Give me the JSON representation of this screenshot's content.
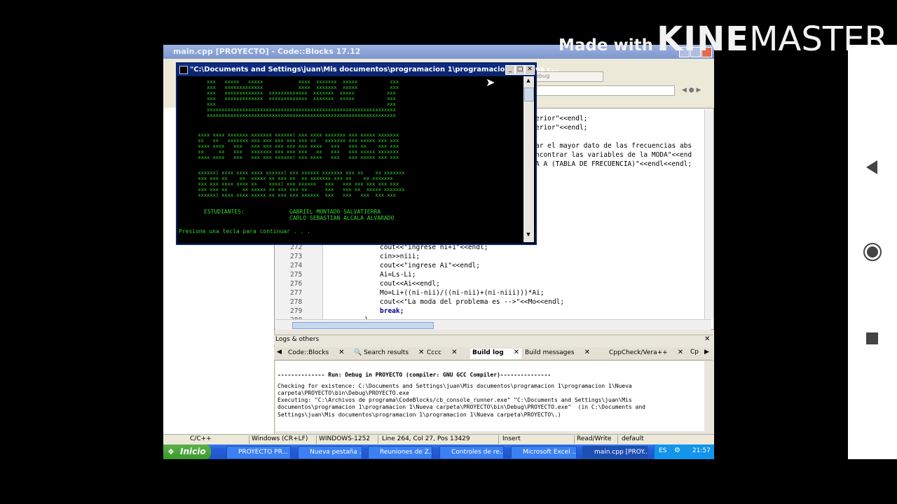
{
  "watermark": {
    "made_with": "Made with",
    "ki": "KINE",
    "master": "MASTER"
  },
  "codeblocks": {
    "title": "main.cpp [PROYECTO] - Code::Blocks 17.12",
    "build_target_hint": "ebug",
    "partial_code": [
      "erior\"<<endl;",
      "erior\"<<endl;",
      "ar el mayor dato de las frecuencias abs",
      "ncontrar las variables de la MODA\"<<end",
      "A A (TABLA DE FRECUENCIA)\"<<endl<<endl;"
    ],
    "code_lines": [
      {
        "num": "272",
        "text": "cout<<\"ingrese ni+1\"<<endl;"
      },
      {
        "num": "273",
        "text": "cin>>niii;"
      },
      {
        "num": "274",
        "text": "cout<<\"ingrese Ai\"<<endl;"
      },
      {
        "num": "275",
        "text": "Ai=Ls-Li;"
      },
      {
        "num": "276",
        "text": "cout<<Ai<<endl;"
      },
      {
        "num": "277",
        "text": "Mo=Li+((ni-nii)/((ni-nii)+(ni-niii)))*Ai;"
      },
      {
        "num": "278",
        "text": "cout<<\"La moda del problema es -->\"<<Mo<<endl;"
      },
      {
        "num": "279",
        "text": "break;"
      },
      {
        "num": "280",
        "text": "}"
      }
    ],
    "logs_title": "Logs & others",
    "log_tabs": [
      "Code::Blocks",
      "Search results",
      "Cccc",
      "Build log",
      "Build messages",
      "CppCheck/Vera++",
      "Cp"
    ],
    "active_tab": "Build log",
    "log_lines": [
      "-------------- Run: Debug in PROYECTO (compiler: GNU GCC Compiler)---------------",
      "Checking for existence: C:\\Documents and Settings\\juan\\Mis documentos\\programacion 1\\programacion 1\\Nueva",
      "carpeta\\PROYECTO\\bin\\Debug\\PROYECTO.exe",
      "Executing: \"C:\\Archivos de programa\\CodeBlocks/cb_console_runner.exe\" \"C:\\Documents and Settings\\juan\\Mis",
      "documentos\\programacion 1\\programacion 1\\Nueva carpeta\\PROYECTO\\bin\\Debug\\PROYECTO.exe\"  (in C:\\Documents and",
      "Settings\\juan\\Mis documentos\\programacion 1\\programacion 1\\Nueva carpeta\\PROYECTO\\.)"
    ],
    "status": {
      "lang": "C/C++",
      "eol": "Windows (CR+LF)",
      "encoding": "WINDOWS-1252",
      "position": "Line 264, Col 27, Pos 13429",
      "mode": "Insert",
      "access": "Read/Write",
      "profile": "default"
    }
  },
  "console": {
    "title": "\"C:\\Documents and Settings\\juan\\Mis documentos\\programacion 1\\programacion 1\\Nueva c...",
    "art1": [
      "          xxx   xxxxx   xxxxx            xxxx  xxxxxxx  xxxxx           xxx",
      "          xxx   xxxxxxxxxxxxx            xxxx  xxxxxxx  xxxxx           xxx",
      "          xxx   xxxxxxxxxxxxx  xxxxxxxxxxxxx  xxxxxxx  xxxxx           xxx",
      "          xxx   xxxxxxxxxxxxx  xxxxxxxxxxxxx  xxxxxxx  xxxxx           xxx",
      "          xxx                                                          xxx",
      "          xxxxxxxxxxxxxxxxxxxxxxxxxxxxxxxxxxxxxxxxxxxxxxxxxxxxxxxxxxxxxxxx",
      "          xxxxxxxxxxxxxxxxxxxxxxxxxxxxxxxxxxxxxxxxxxxxxxxxxxxxxxxxxxxxxxxx"
    ],
    "art2": [
      "       xxxx xxxx xxxxxxx xxxxxxx xxxxxx) xxx xxxx xxxxxxx xxx xxxxx xxxxxxx",
      "       xx   xx   xxxxxxx xxx xxx xxx xxx xxx xx   xxxxxxx xxx xxxxx xxx xxx",
      "       xxxx xxxx   xxx   xxx xxx xxx xxx xxx xxxx   xxx   xxx xx    xxx xxx",
      "       xx     xx   xxx   xxxxxxx xxx xxx xxx   xx   xxx   xxx xxxxx xxxxxxx",
      "       xxxx xxxx   xxx   xxx xxx xxxxxx) xxx xxxx   xxx   xxx xxxxx xxx xxx"
    ],
    "art3": [
      "       xxxxxx) xxxx xxxx xxxx xxxxxx) xxx xxxxxx xxxxxxx xxx xx    xx xxxxxxx",
      "       xxx xxx xx    xx  xxxxx xx xxx xx  xx xxxxxxx xxx xx    xx xxxxxxx",
      "       xxx xxx xxxx xxxx xx    xxxx) xxx xxxxxx   xxx   xxx xxx xxx xxx xxx",
      "       xxx xxx xx     xx xxxxx xx xxx xxx xx      xxx   xxx xx  xxxxx xxxxxxx",
      "       xxxxxx) xxxx xxxx xxxxx xx xxx xxx xxxxxx  xxx   xxx   xxx  xxx xxx"
    ],
    "students_label": "ESTUDIANTES:",
    "student1": "GABRIEL MONTADO SALVATIERRA",
    "student2": "CARLO SEBASTIAN ALCALA ALVARADO",
    "prompt": "Presione una tecla para continuar . . ."
  },
  "taskbar": {
    "start": "Inicio",
    "tasks": [
      "PROYECTO PR...",
      "Nueva pestaña ...",
      "Reuniones de Z...",
      "Controles de re...",
      "Microsoft Excel ...",
      "main.cpp [PROY..."
    ],
    "lang": "ES",
    "time": "21:57"
  },
  "colors": {
    "console_text": "#39d234",
    "xp_blue": "#245edb",
    "console_title": "#0a246a"
  }
}
